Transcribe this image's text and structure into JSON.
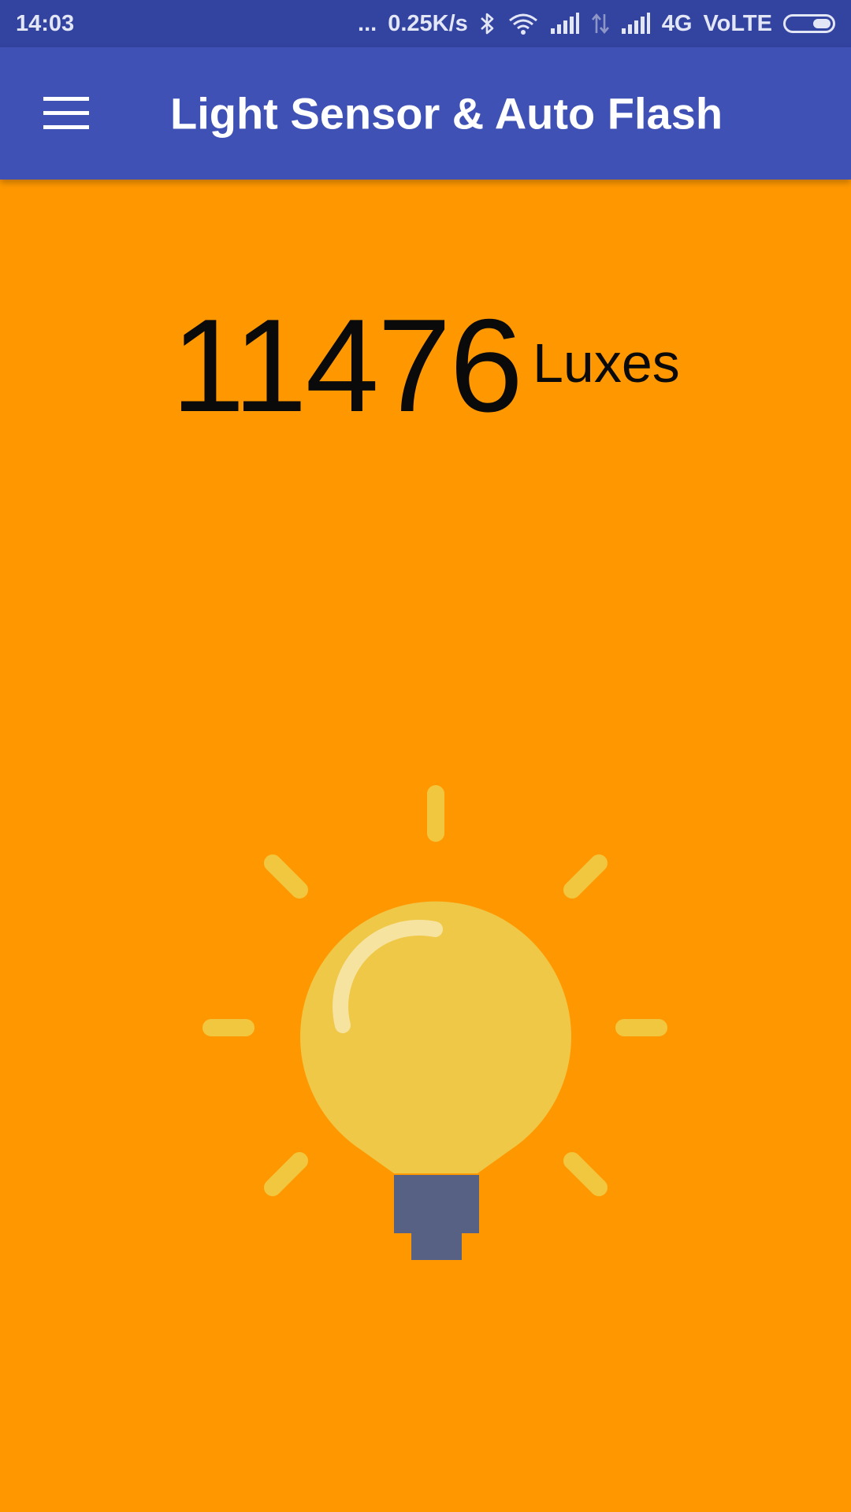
{
  "status_bar": {
    "time": "14:03",
    "dots": "...",
    "speed": "0.25K/s",
    "network": "4G",
    "volte": "VoLTE"
  },
  "app_bar": {
    "title": "Light Sensor & Auto Flash",
    "menu_icon": "hamburger-menu-icon"
  },
  "reading": {
    "value": "11476",
    "unit": "Luxes"
  },
  "colors": {
    "status_bar": "#3343A0",
    "app_bar": "#3F51B5",
    "background": "#FF9800",
    "bulb_glass": "#EFC847",
    "bulb_rays": "#F1C740",
    "bulb_base": "#566183"
  },
  "bulb_icon": "lightbulb-icon"
}
